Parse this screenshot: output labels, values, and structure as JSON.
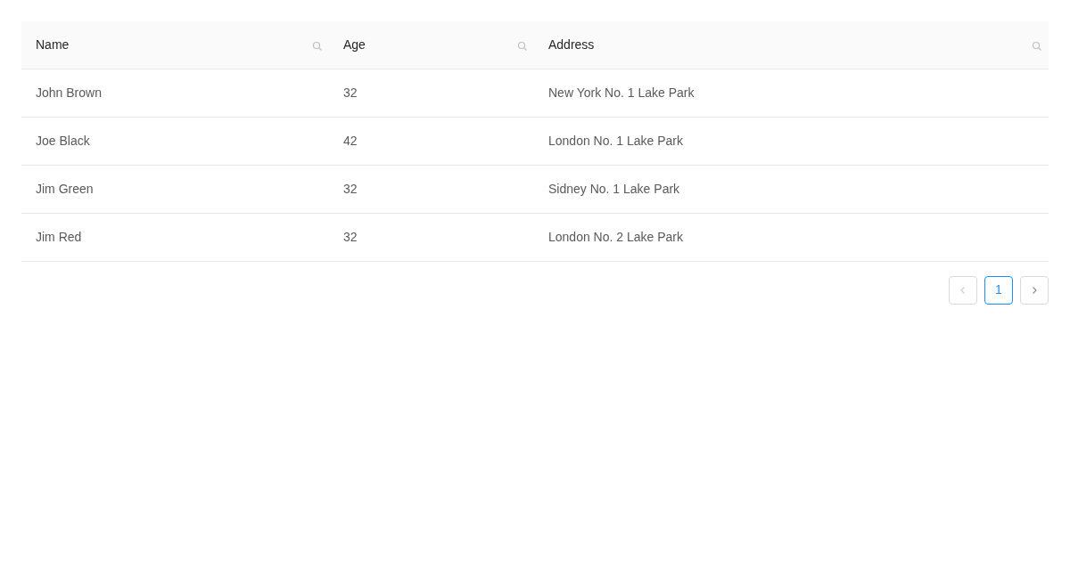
{
  "table": {
    "columns": [
      {
        "label": "Name"
      },
      {
        "label": "Age"
      },
      {
        "label": "Address"
      }
    ],
    "rows": [
      {
        "cells": [
          "John Brown",
          "32",
          "New York No. 1 Lake Park"
        ]
      },
      {
        "cells": [
          "Joe Black",
          "42",
          "London No. 1 Lake Park"
        ]
      },
      {
        "cells": [
          "Jim Green",
          "32",
          "Sidney No. 1 Lake Park"
        ]
      },
      {
        "cells": [
          "Jim Red",
          "32",
          "London No. 2 Lake Park"
        ]
      }
    ]
  },
  "pagination": {
    "prev": {
      "disabled": true
    },
    "pages": [
      {
        "label": "1",
        "selected": true
      }
    ],
    "next": {
      "disabled": false
    }
  }
}
